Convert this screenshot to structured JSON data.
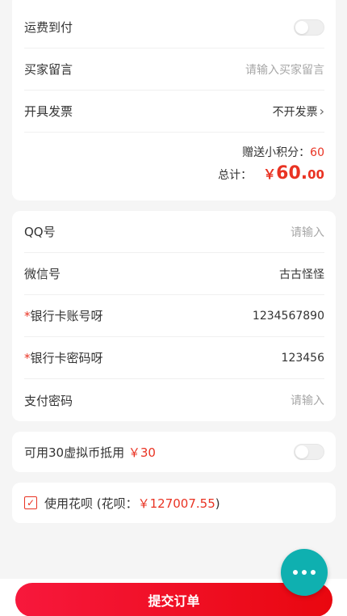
{
  "order": {
    "freight_collect_label": "运费到付",
    "message_label": "买家留言",
    "message_placeholder": "请输入买家留言",
    "invoice_label": "开具发票",
    "invoice_value": "不开发票",
    "points_label": "赠送小积分：",
    "points_value": "60",
    "total_label": "总计：",
    "total_currency": "￥",
    "total_int": "60.",
    "total_dec": "00"
  },
  "form": {
    "qq_label": "QQ号",
    "qq_placeholder": "请输入",
    "wechat_label": "微信号",
    "wechat_value": "古古怪怪",
    "required_mark": "*",
    "bank_card_label": "银行卡账号呀",
    "bank_card_value": "1234567890",
    "bank_pwd_label": "银行卡密码呀",
    "bank_pwd_value": "123456",
    "pay_pwd_label": "支付密码",
    "pay_pwd_placeholder": "请输入"
  },
  "virtual_coin": {
    "label": "可用30虚拟币抵用",
    "amount": "￥30"
  },
  "huabei": {
    "label": "使用花呗 (花呗：",
    "amount": "￥127007.55",
    "close": ")"
  },
  "submit_label": "提交订单",
  "icons": {
    "chevron": "chevron-right-icon",
    "check": "check-icon",
    "chat": "more-dots-icon"
  },
  "colors": {
    "accent": "#e93323",
    "fab": "#0fb0b0"
  }
}
